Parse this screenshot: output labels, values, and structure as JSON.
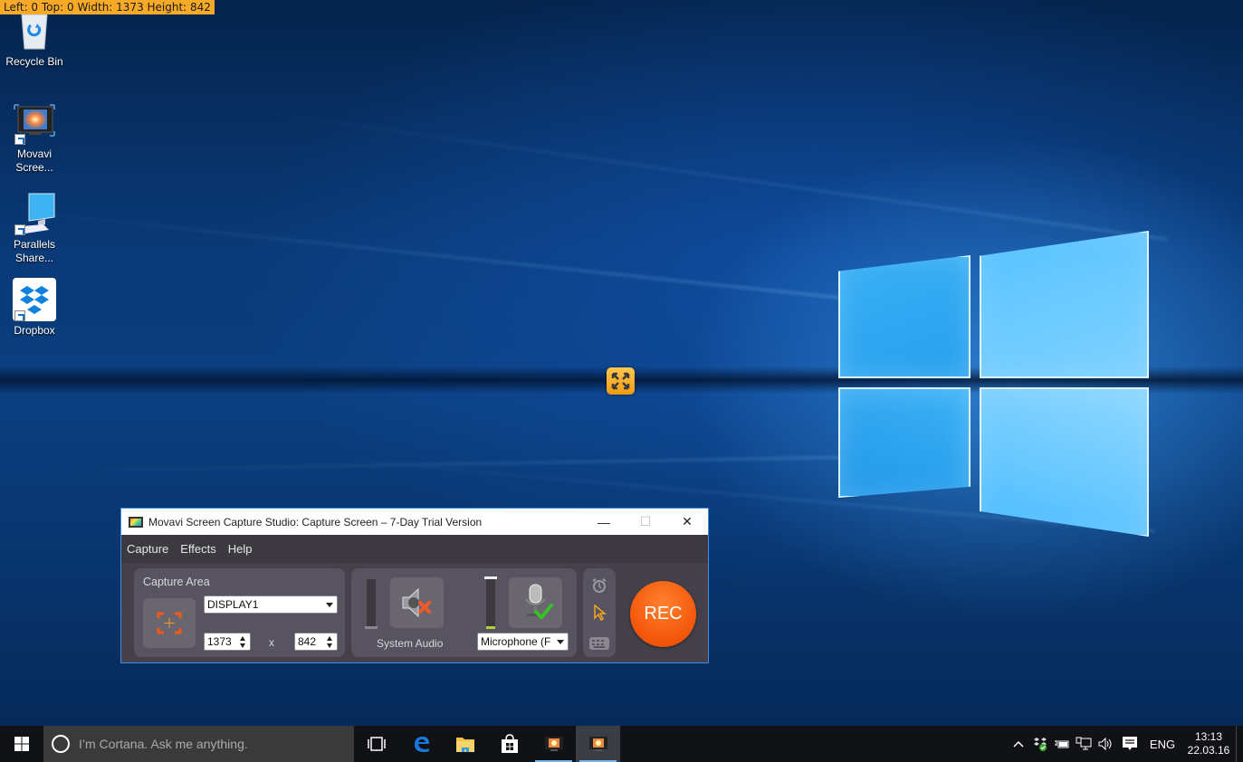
{
  "overlay": {
    "measure_text": "Left: 0  Top: 0  Width: 1373  Height: 842"
  },
  "desktop": {
    "icons": [
      {
        "label": "Recycle Bin",
        "icon": "recycle-bin-icon"
      },
      {
        "label": "Movavi Scree...",
        "icon": "movavi-icon",
        "shortcut": true
      },
      {
        "label": "Parallels Share...",
        "icon": "parallels-monitor-icon",
        "shortcut": true
      },
      {
        "label": "Dropbox",
        "icon": "dropbox-icon",
        "shortcut": true
      }
    ],
    "expand_button_icon": "expand-arrows-icon"
  },
  "window": {
    "title": "Movavi Screen Capture Studio: Capture Screen – 7-Day Trial Version",
    "controls": {
      "minimize": "—",
      "maximize": "☐",
      "close": "✕"
    },
    "menu": [
      "Capture",
      "Effects",
      "Help"
    ],
    "capture_area": {
      "label": "Capture Area",
      "display_select": "DISPLAY1",
      "width": "1373",
      "height": "842",
      "separator": "x"
    },
    "audio": {
      "system_audio_label": "System Audio",
      "system_audio_enabled": false,
      "microphone_select": "Microphone (F",
      "microphone_enabled": true
    },
    "tools": [
      "alarm-clock-icon",
      "cursor-icon",
      "keyboard-icon"
    ],
    "rec_label": "REC",
    "colors": {
      "rec": "#f55a0c",
      "accent_orange": "#f26b1d",
      "panel": "#575360"
    }
  },
  "taskbar": {
    "cortana_placeholder": "I’m Cortana. Ask me anything.",
    "apps": [
      "task-view-icon",
      "edge-icon",
      "file-explorer-icon",
      "store-icon",
      "movavi-icon",
      "movavi-icon"
    ],
    "tray": {
      "language": "ENG",
      "time": "13:13",
      "date": "22.03.16"
    }
  }
}
